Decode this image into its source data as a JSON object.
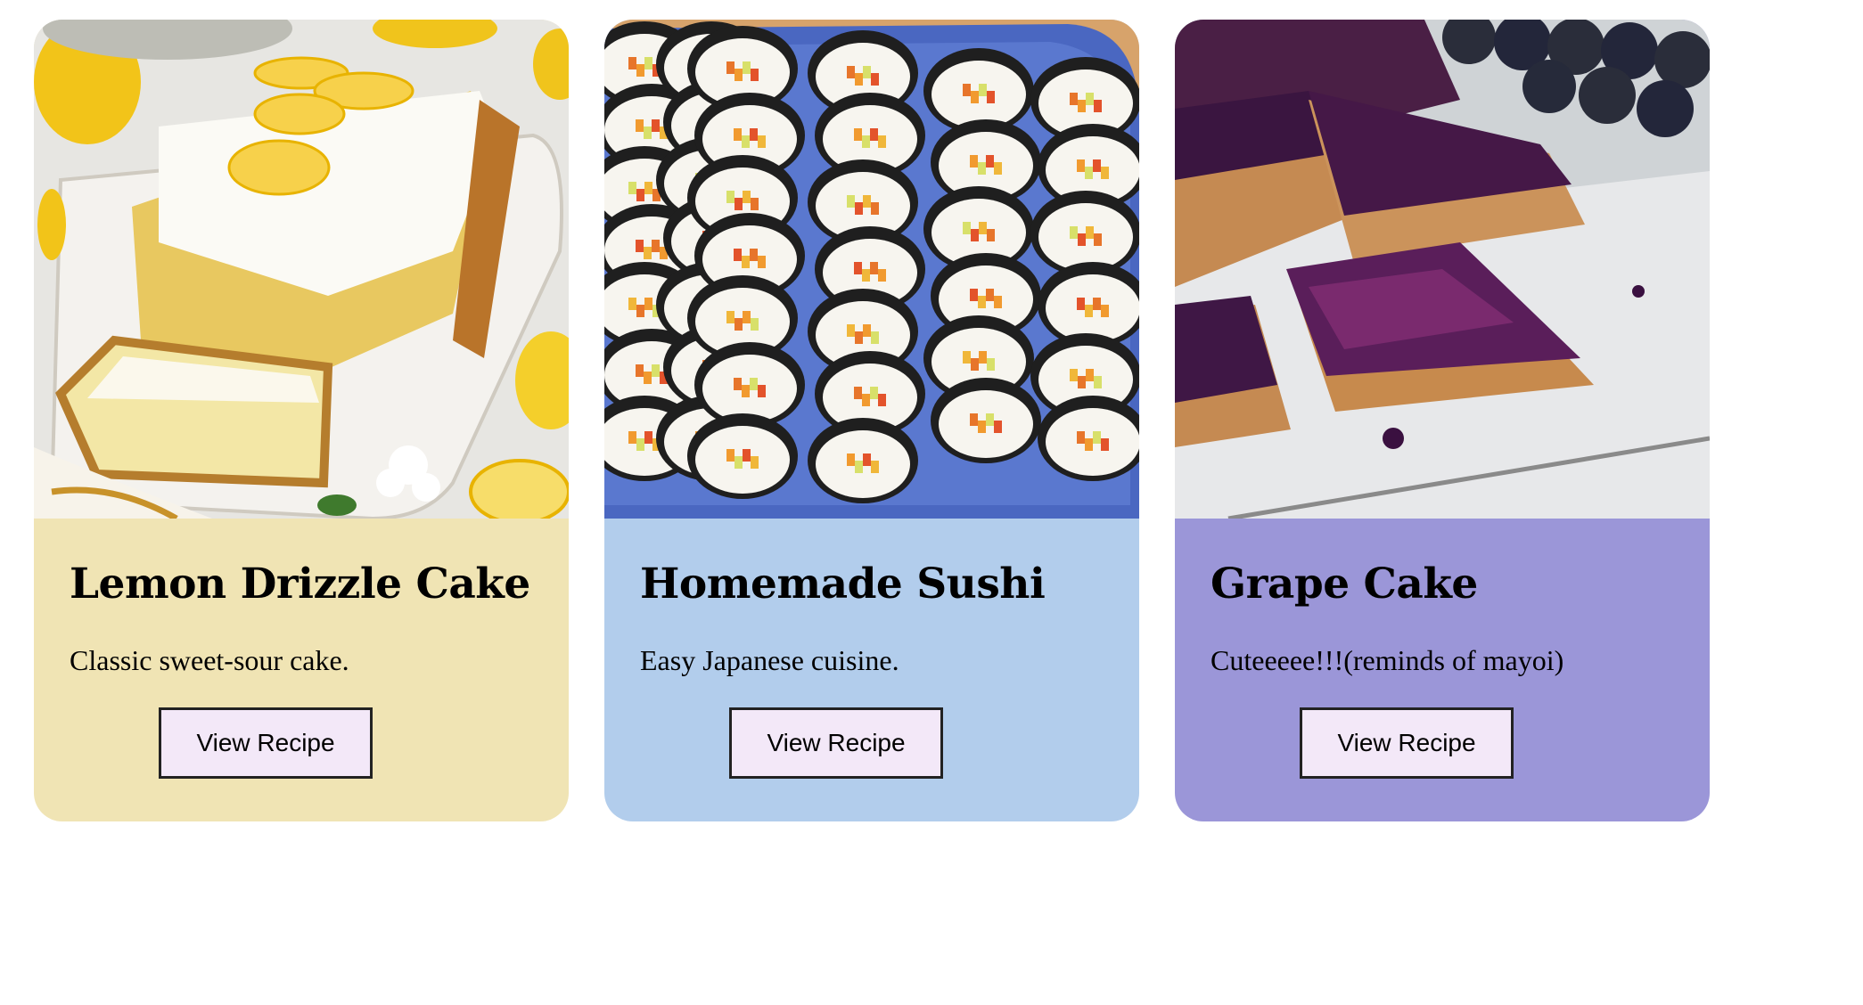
{
  "cards": [
    {
      "title": "Lemon Drizzle Cake",
      "description": "Classic sweet-sour cake.",
      "button_label": "View Recipe",
      "background": "#f0e4b4",
      "image": "lemon-drizzle-cake-photo"
    },
    {
      "title": "Homemade Sushi",
      "description": "Easy Japanese cuisine.",
      "button_label": "View Recipe",
      "background": "#b2cdec",
      "image": "homemade-sushi-photo"
    },
    {
      "title": "Grape Cake",
      "description": "Cuteeeee!!!(reminds of mayoi)",
      "button_label": "View Recipe",
      "background": "#9b96d8",
      "image": "grape-cake-photo"
    }
  ]
}
